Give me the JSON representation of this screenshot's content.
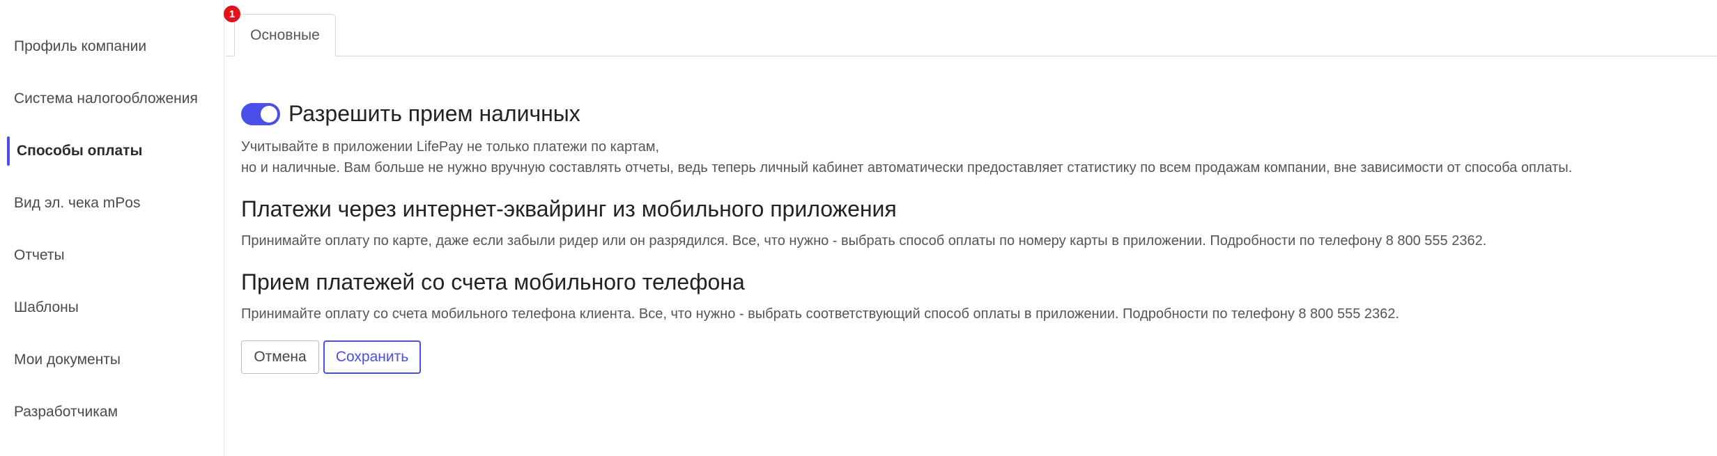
{
  "sidebar": {
    "items": [
      {
        "label": "Профиль компании",
        "active": false
      },
      {
        "label": "Система налогообложения",
        "active": false
      },
      {
        "label": "Способы оплаты",
        "active": true
      },
      {
        "label": "Вид эл. чека mPos",
        "active": false
      },
      {
        "label": "Отчеты",
        "active": false
      },
      {
        "label": "Шаблоны",
        "active": false
      },
      {
        "label": "Мои документы",
        "active": false
      },
      {
        "label": "Разработчикам",
        "active": false
      }
    ]
  },
  "tabs": {
    "badge_count": "1",
    "items": [
      {
        "label": "Основные"
      }
    ]
  },
  "cash": {
    "enabled": true,
    "title": "Разрешить прием наличных",
    "desc_line1": "Учитывайте в приложении LifePay не только платежи по картам,",
    "desc_line2": "но и наличные. Вам больше не нужно вручную составлять отчеты, ведь теперь личный кабинет автоматически предоставляет статистику по всем продажам компании, вне зависимости от способа оплаты."
  },
  "acquiring": {
    "title": "Платежи через интернет-эквайринг из мобильного приложения",
    "desc": "Принимайте оплату по карте, даже если забыли ридер или он разрядился. Все, что нужно - выбрать способ оплаты по номеру карты в приложении. Подробности по телефону 8 800 555 2362."
  },
  "mobile": {
    "title": "Прием платежей со счета мобильного телефона",
    "desc": "Принимайте оплату со счета мобильного телефона клиента. Все, что нужно - выбрать соответствующий способ оплаты в приложении. Подробности по телефону 8 800 555 2362."
  },
  "actions": {
    "cancel_label": "Отмена",
    "save_label": "Сохранить"
  },
  "colors": {
    "accent": "#4b4ee8",
    "badge": "#e3121b"
  }
}
